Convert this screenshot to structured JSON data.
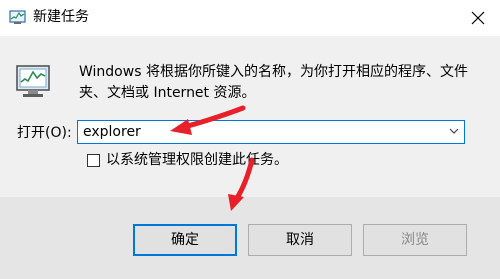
{
  "window": {
    "title": "新建任务"
  },
  "icons": {
    "title": "task-manager-icon",
    "program": "task-manager-icon",
    "close": "close-icon",
    "dropdown": "chevron-down-icon"
  },
  "dialog": {
    "description_line1": "Windows 将根据你所键入的名称，为你打开相应的程序、文件",
    "description_line2": "夹、文档或 Internet 资源。",
    "open_label": "打开(O):",
    "open_value": "explorer",
    "admin_checkbox_label": "以系统管理权限创建此任务。",
    "admin_checkbox_checked": false
  },
  "buttons": {
    "ok": "确定",
    "cancel": "取消",
    "browse": "浏览"
  },
  "colors": {
    "accent": "#0078d7",
    "arrow": "#e8202a"
  }
}
